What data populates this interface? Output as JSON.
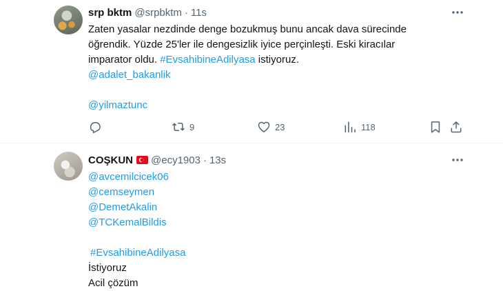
{
  "tweets": [
    {
      "author": {
        "name": "srp bktm",
        "handle": "@srpbktm",
        "separator": "·",
        "time": "11s"
      },
      "text_lines": [
        "Zaten yasalar nezdinde denge bozukmuş bunu ancak dava sürecinde",
        "öğrendik. Yüzde 25'ler ile dengesizlik iyice perçinleşti. Eski kiracılar",
        "imparator oldu. "
      ],
      "hashtag": "#EvsahibineAdilyasa",
      "hashtag_suffix": " istiyoruz.",
      "mentions": [
        "@adalet_bakanlik",
        "@yilmaztunc"
      ],
      "stats": {
        "replies": "",
        "retweets": "9",
        "likes": "23",
        "views": "118"
      },
      "icons": {
        "reply": "reply-icon",
        "retweet": "retweet-icon",
        "like": "heart-icon",
        "views": "views-icon",
        "bookmark": "bookmark-icon",
        "share": "share-icon",
        "more": "more-icon"
      }
    },
    {
      "author": {
        "name": "COŞKUN",
        "handle": "@ecy1903",
        "separator": "·",
        "time": "13s",
        "flag": "turkey-flag-icon"
      },
      "mentions": [
        "@avcemilcicek06",
        "@cemseymen",
        "@DemetAkalin",
        "@TCKemalBildis"
      ],
      "hashtag": "#EvsahibineAdilyasa",
      "text_lines": [
        "İstiyoruz",
        "Acil çözüm"
      ]
    }
  ],
  "colors": {
    "text": "#0f1419",
    "secondary": "#536471",
    "link": "#1d9bf0",
    "divider": "#eff3f4",
    "flag": "#e30a17"
  }
}
